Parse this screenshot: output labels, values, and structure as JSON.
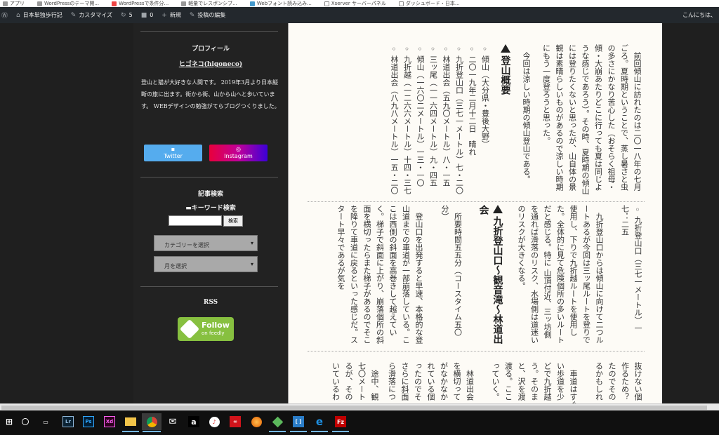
{
  "bookmarks": [
    "アプリ",
    "WordPressのテーマ開...",
    "WordPressで条件分...",
    "軽量でレスポンシブ...",
    "Webフォント読み込み...",
    "Xserver サーバーパネル",
    "ダッシュボード・日本..."
  ],
  "adminbar": {
    "site": "日本単独歩行記",
    "customize": "カスタマイズ",
    "updates": "5",
    "comments": "0",
    "new": "新規",
    "edit": "投稿の編集",
    "greeting": "こんにちは、"
  },
  "sidebar": {
    "profile_title": "プロフィール",
    "profile_name": "ヒゴネコ(higoneco)",
    "bio": "登山と猫が大好きな人間です。 2019年3月より日本縦断の旅に出ます。街から街、山から山へと歩いています。 WEBデザインの勉強がてらブログつくりました。",
    "twitter": "Twitter",
    "instagram": "Instagram",
    "search_title": "記事検索",
    "keyword_title": "キーワード検索",
    "search_value": "",
    "search_button": "検索",
    "category_select": "カテゴリーを選択",
    "month_select": "月を選択",
    "rss_title": "RSS",
    "feedly_line1": "Follow",
    "feedly_line2": "on feedly",
    "colors": {
      "twitter": "#55acee",
      "instagram_from": "#e8003c",
      "instagram_to": "#3b00d8",
      "feedly": "#87c040"
    }
  },
  "article": {
    "s1": {
      "p1": "前回傾山に訪れたのは二〇一八年の七月ごろ。夏時期ということで、蒸し暑さと虫の多さにかなり苦心した（おそらく祖母・傾・大崩あたりどこに行っても夏は同じような感じであろう）。その時、夏時期の傾山には登りたくないと思ったが、山自体の景観は素晴らしいものがあるので涼しい時期にもう一度登ろうと思った。",
      "p2": "今回は涼しい時期の傾山登山である。",
      "heading": "登山概要",
      "list": [
        "傾山（大分県・豊後大野）",
        "二〇一九年二月十二日　晴れ",
        "九折登山口（三七一メートル）七・二〇",
        "林道出会（五九〇メートル）八・一五",
        "三ッ尾（一一六四メートル）九・四五",
        "傾山（一六〇二メートル）一三・一〇",
        "九折越（一二六六メートル）十四・三七",
        "林道出会（八九八メートル）一五・二〇"
      ]
    },
    "s2": {
      "list": [
        "九折登山口（三七一メートル）一七：二五"
      ],
      "p1": "九折登山口からは傾山に向けて二つルートあるが今回は三ッ尾ルートを登りで使用し、下りで九折越ルートを使用した。全体的に見て危険個所の多いルートだと感じる。特に 山頂付近、三ッ坊側を通れば滑落のリスク、水場側は道迷いのリスクが大きくなる。",
      "heading": "九折登山口～観音滝～林道出会",
      "p2": "所要時間五五分（コースタイム五〇分）",
      "p3": "登山口を出発すると早速、本格的な登山道までの車道が一部崩落している。ここは西側の斜面を高巻きして越えていく。梯子で斜面に上がり、崩落個所の斜面を横切ったらまた梯子があるのでそこを降りて車道に戻るといった感じだ。スタート早々であるが気を"
    },
    "s3": {
      "p1": [
        "抜けない個",
        "作るため？",
        "たのでその",
        "るかもしれ"
      ],
      "p2": [
        "車道はすぐ",
        "い歩道を少",
        "どで九折越",
        "う。そのま",
        "と、沢を渡",
        "渡る。ここ",
        "っていく。"
      ],
      "p3": [
        "林道出会",
        "を横切って",
        "がなかなか",
        "れている個",
        "ったのでそ",
        "さらに斜面",
        "ら滑落につ"
      ],
      "p4": [
        "途中、観",
        "七〇メート",
        "るが、その",
        "いているわ"
      ]
    }
  },
  "taskbar": [
    "start",
    "search",
    "task-view",
    "Lr",
    "Ps",
    "Xd",
    "file-explorer",
    "chrome",
    "mail",
    "amazon",
    "itunes",
    "creative-cloud",
    "firefox",
    "app-green",
    "brackets",
    "edge",
    "filezilla"
  ]
}
